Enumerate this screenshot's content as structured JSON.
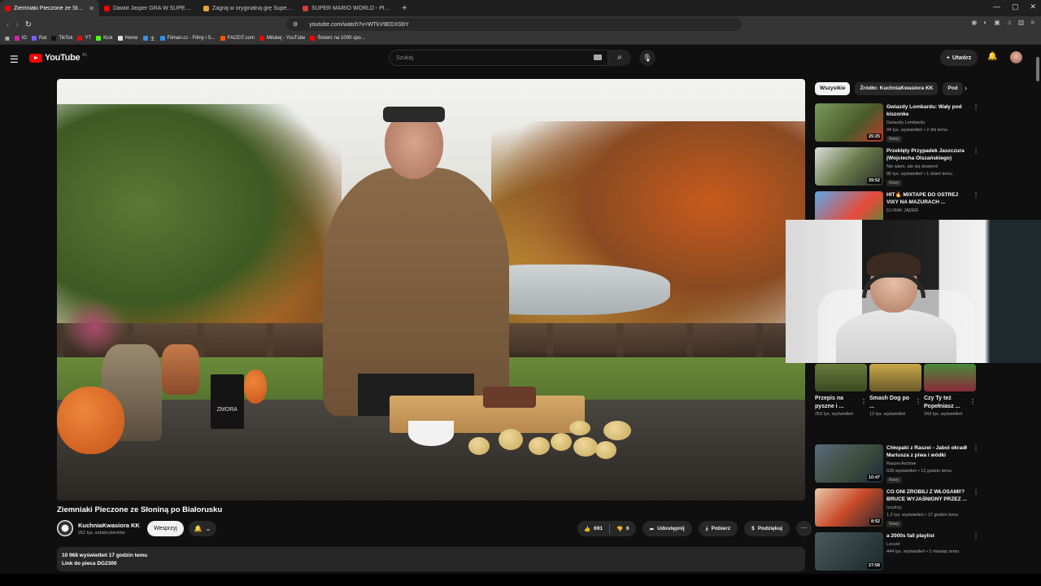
{
  "browser": {
    "tabs": [
      {
        "title": "Ziemniaki Pieczone ze Słonin",
        "active": true,
        "fav_color": "#ff0000"
      },
      {
        "title": "Dawid Jasper GRA W SUPER MARIO",
        "active": false,
        "fav_color": "#ff0000"
      },
      {
        "title": "Zagraj w oryginalną grę Super Mario",
        "active": false,
        "fav_color": "#e8a33a"
      },
      {
        "title": "SUPER MARIO WORLD - Play the re",
        "active": false,
        "fav_color": "#d93b3b"
      }
    ],
    "new_tab": "+",
    "url": "youtube.com/watch?v=WTkV9EDXSbY",
    "bookmarks": [
      {
        "label": "IG",
        "color": "#d6249f"
      },
      {
        "label": "Rat",
        "color": "#7a5af8"
      },
      {
        "label": "TikTok",
        "color": "#111111"
      },
      {
        "label": "YT",
        "color": "#ff0000"
      },
      {
        "label": "Kick",
        "color": "#53fc18"
      },
      {
        "label": "Home",
        "color": "#dddddd"
      },
      {
        "label": "王",
        "color": "#3a8ee6"
      },
      {
        "label": "Filman.cc - Filmy i S...",
        "color": "#3a8ee6"
      },
      {
        "label": "FACEIT.com",
        "color": "#ff5500"
      },
      {
        "label": "Milukej - YouTube",
        "color": "#ff0000"
      },
      {
        "label": "Śmierć na 1000 spo...",
        "color": "#ff0000"
      }
    ]
  },
  "youtube": {
    "logo": "YouTube",
    "country": "PL",
    "search_placeholder": "Szukaj",
    "create_label": "Utwórz"
  },
  "video": {
    "bag_label": "ZMORA",
    "title": "Ziemniaki Pieczone ze Słoniną po Białorusku",
    "channel": "KuchniaKwasiora KK",
    "subscribers": "251 tys. subskrybentów",
    "support_label": "Wesprzyj",
    "likes": "691",
    "dislikes": "6",
    "share": "Udostępnij",
    "download": "Pobierz",
    "thanks": "Podziękuj",
    "views_line": "10 968 wyświetleń  17 godzin temu",
    "desc_line": "Link do pieca DG2300"
  },
  "sidebar": {
    "chips": [
      "Wszystkie",
      "Źródło: KuchniaKwasiora KK",
      "Pod"
    ],
    "recs_top": [
      {
        "title": "Gwiazdy Lombardu: Wały pod kiszonke",
        "channel": "Gwiazdy Lombardu",
        "meta": "94 tys. wyświetleń • 2 dni temu",
        "badge": "Nowy",
        "duration": "25:25",
        "thumb": "#6a8a5a"
      },
      {
        "title": "Przeklęty Przypadek Jaszczura (Wojciecha Olszańskiego)",
        "channel": "Nie wiem, ale się dowiem!",
        "meta": "85 tys. wyświetleń • 1 dzień temu",
        "badge": "Nowy",
        "duration": "39:52",
        "thumb": "#4a5a3a"
      },
      {
        "title": "HIT🔥 MIXTAPE DO OSTREJ VIXY NA MAZURACH ...",
        "channel": "DJ RAK JĄDER",
        "meta": "",
        "badge": "",
        "duration": "",
        "thumb": "#5a8ab8"
      }
    ],
    "shorts": [
      {
        "title": "Przepis na pyszne i ...",
        "views": "253 tys. wyświetleń",
        "thumb": "#5a6a3a"
      },
      {
        "title": "Smash Dog po ...",
        "views": "12 tys. wyświetleń",
        "thumb": "#8a7a3a"
      },
      {
        "title": "Czy Ty też Popełniasz ...",
        "views": "243 tys. wyświetleń",
        "thumb": "#6a2a2a"
      }
    ],
    "recs_bottom": [
      {
        "title": "Chłopaki z Raszei - Jabol okradł Mariusza z piwa i wódki",
        "channel": "Raszei Archive",
        "meta": "628 wyświetleń • 12 godzin temu",
        "badge": "Nowy",
        "duration": "10:47",
        "thumb": "#3a4a5a"
      },
      {
        "title": "CO ONI ZROBILI Z WŁOSAMI!? BRUCE WYJAŚNIONY PRZEZ ...",
        "channel": "Izzytrzy",
        "meta": "1,2 tys. wyświetleń • 17 godzin temu",
        "badge": "Nowy",
        "duration": "8:52",
        "thumb": "#aa5a3a"
      },
      {
        "title": "a 2000s fall playlist",
        "channel": "Locust",
        "meta": "444 tys. wyświetleń • 1 miesiąc temu",
        "badge": "",
        "duration": "27:58",
        "thumb": "#2a3a3a"
      }
    ]
  }
}
